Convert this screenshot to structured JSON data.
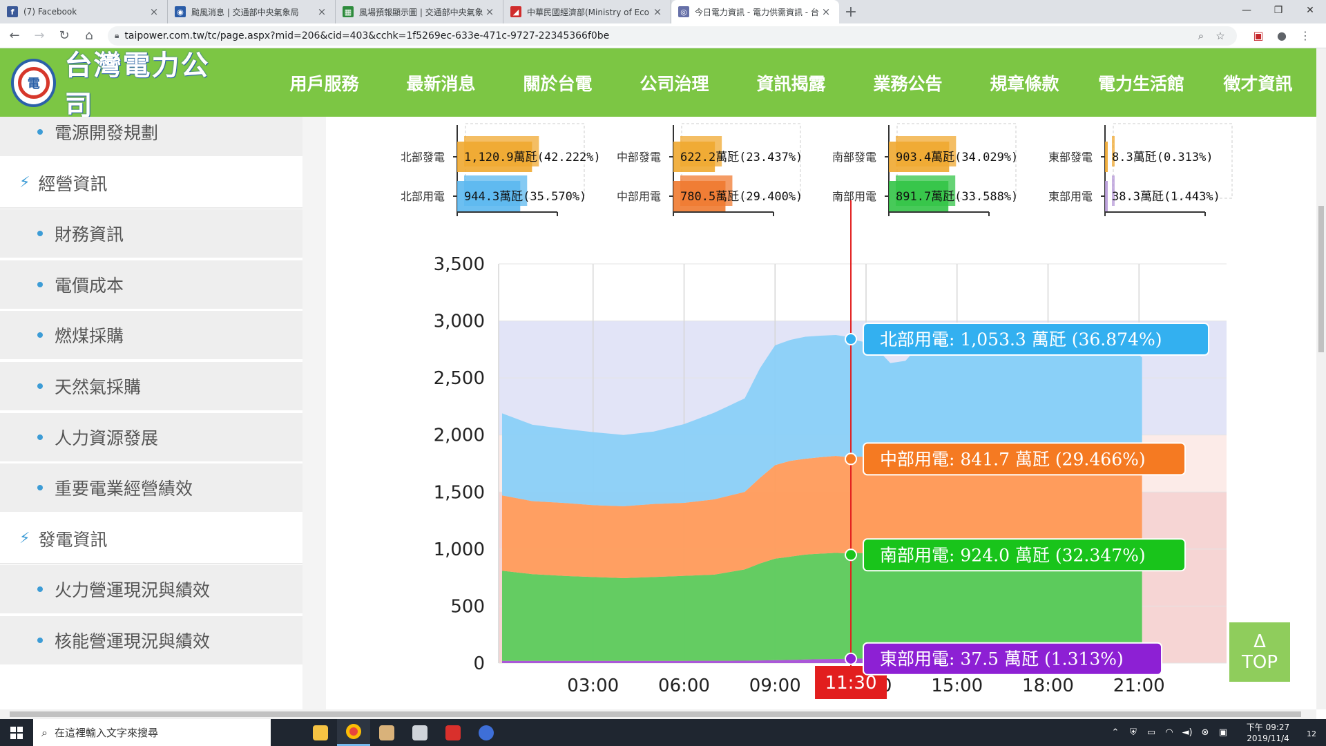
{
  "browser": {
    "tabs": [
      {
        "title": "(7) Facebook",
        "favicon": "facebook-icon",
        "color": "#3b5998",
        "glyph": "f"
      },
      {
        "title": "颱風消息 | 交通部中央氣象局",
        "favicon": "cwb-icon",
        "color": "#2a5ca8",
        "glyph": "◉"
      },
      {
        "title": "風場預報顯示圖 | 交通部中央氣象",
        "favicon": "wind-map-icon",
        "color": "#2e8b3d",
        "glyph": "▦"
      },
      {
        "title": "中華民國經濟部(Ministry of Eco",
        "favicon": "moea-icon",
        "color": "#d02c2c",
        "glyph": "◢"
      },
      {
        "title": "今日電力資訊 - 電力供需資訊 - 台",
        "favicon": "taipower-icon",
        "color": "#6670a8",
        "glyph": "◎"
      }
    ],
    "url": "taipower.com.tw/tc/page.aspx?mid=206&cid=403&cchk=1f5269ec-633e-471c-9727-22345366f0be"
  },
  "site": {
    "logo_text": "台灣電力公司",
    "logo_glyph": "電",
    "nav": [
      "用戶服務",
      "最新消息",
      "關於台電",
      "公司治理",
      "資訊揭露",
      "業務公告",
      "規章條款",
      "電力生活館",
      "徵才資訊"
    ]
  },
  "sidebar": {
    "items": [
      {
        "type": "sub",
        "label": "電源開發規劃"
      },
      {
        "type": "cat",
        "label": "經營資訊"
      },
      {
        "type": "sub",
        "label": "財務資訊"
      },
      {
        "type": "sub",
        "label": "電價成本"
      },
      {
        "type": "sub",
        "label": "燃煤採購"
      },
      {
        "type": "sub",
        "label": "天然氣採購"
      },
      {
        "type": "sub",
        "label": "人力資源發展"
      },
      {
        "type": "sub",
        "label": "重要電業經營績效"
      },
      {
        "type": "cat",
        "label": "發電資訊"
      },
      {
        "type": "sub",
        "label": "火力營運現況與績效"
      },
      {
        "type": "sub",
        "label": "核能營運現況與績效"
      }
    ]
  },
  "chart_data": [
    {
      "type": "bar",
      "panels": [
        {
          "rows": [
            {
              "label": "北部發電",
              "value": 1120.9,
              "text": "1,120.9萬瓩(42.222%)",
              "color": "#f0a830"
            },
            {
              "label": "北部用電",
              "value": 944.3,
              "text": "944.3萬瓩(35.570%)",
              "color": "#5cb8ef"
            }
          ]
        },
        {
          "rows": [
            {
              "label": "中部發電",
              "value": 622.2,
              "text": "622.2萬瓩(23.437%)",
              "color": "#f0a830"
            },
            {
              "label": "中部用電",
              "value": 780.5,
              "text": "780.5萬瓩(29.400%)",
              "color": "#f07a30"
            }
          ]
        },
        {
          "rows": [
            {
              "label": "南部發電",
              "value": 903.4,
              "text": "903.4萬瓩(34.029%)",
              "color": "#f0a830"
            },
            {
              "label": "南部用電",
              "value": 891.7,
              "text": "891.7萬瓩(33.588%)",
              "color": "#33c447"
            }
          ]
        },
        {
          "rows": [
            {
              "label": "東部發電",
              "value": 8.3,
              "text": "8.3萬瓩(0.313%)",
              "color": "#f0a830"
            },
            {
              "label": "東部用電",
              "value": 38.3,
              "text": "38.3萬瓩(1.443%)",
              "color": "#b79ad8"
            }
          ]
        }
      ],
      "xticks": [
        "0",
        "1,500"
      ],
      "xlim": [
        0,
        2000
      ]
    },
    {
      "type": "area",
      "stacked": true,
      "ylim": [
        0,
        3500
      ],
      "yticks": [
        "3,500",
        "3,000",
        "2,500",
        "2,000",
        "1,500",
        "1,000",
        "500",
        "0"
      ],
      "xticks": [
        "03:00",
        "06:00",
        "09:00",
        "12:00",
        "15:00",
        "18:00",
        "21:00"
      ],
      "x_range_hours": [
        0,
        24
      ],
      "bands": [
        {
          "from": 3000,
          "to": 3500,
          "color": "#ffffff"
        },
        {
          "from": 2000,
          "to": 3000,
          "color": "#e2e4f7"
        },
        {
          "from": 1500,
          "to": 2000,
          "color": "#fcebe8"
        },
        {
          "from": 0,
          "to": 1500,
          "color": "#f6d5d4"
        }
      ],
      "series": [
        {
          "name": "東部用電",
          "color": "#a650d8",
          "points": [
            [
              0,
              20
            ],
            [
              2,
              20
            ],
            [
              4,
              20
            ],
            [
              6,
              20
            ],
            [
              8,
              21
            ],
            [
              9.5,
              28
            ],
            [
              10.5,
              35
            ],
            [
              11.5,
              37.5
            ]
          ]
        },
        {
          "name": "南部用電",
          "color": "#5ccb5c",
          "points": [
            [
              0,
              790
            ],
            [
              1,
              760
            ],
            [
              2,
              745
            ],
            [
              3,
              735
            ],
            [
              4,
              725
            ],
            [
              5,
              735
            ],
            [
              6,
              745
            ],
            [
              7,
              755
            ],
            [
              8,
              800
            ],
            [
              8.5,
              850
            ],
            [
              9,
              890
            ],
            [
              9.5,
              905
            ],
            [
              10,
              920
            ],
            [
              11,
              930
            ],
            [
              11.5,
              924
            ]
          ]
        },
        {
          "name": "中部用電",
          "color": "#ff9c5c",
          "points": [
            [
              0,
              660
            ],
            [
              1,
              640
            ],
            [
              2,
              640
            ],
            [
              3,
              630
            ],
            [
              4,
              630
            ],
            [
              5,
              640
            ],
            [
              6,
              640
            ],
            [
              7,
              660
            ],
            [
              8,
              680
            ],
            [
              8.5,
              750
            ],
            [
              9,
              820
            ],
            [
              9.5,
              840
            ],
            [
              10,
              840
            ],
            [
              11,
              850
            ],
            [
              11.5,
              842
            ]
          ]
        },
        {
          "name": "北部用電",
          "color": "#8ad0f8",
          "points": [
            [
              0,
              720
            ],
            [
              1,
              670
            ],
            [
              2,
              650
            ],
            [
              3,
              640
            ],
            [
              4,
              625
            ],
            [
              5,
              635
            ],
            [
              6,
              690
            ],
            [
              7,
              760
            ],
            [
              7.5,
              790
            ],
            [
              8,
              820
            ],
            [
              8.5,
              960
            ],
            [
              9,
              1050
            ],
            [
              9.5,
              1060
            ],
            [
              10,
              1070
            ],
            [
              11,
              1060
            ],
            [
              11.5,
              1053
            ]
          ]
        },
        {
          "name": "北部用電 (forecast)",
          "color": "#8ad0f8",
          "points": [
            [
              11.5,
              2840
            ],
            [
              12.2,
              2800
            ],
            [
              12.8,
              2630
            ],
            [
              13.3,
              2650
            ],
            [
              13.8,
              2800
            ],
            [
              14.5,
              2730
            ],
            [
              16,
              2700
            ],
            [
              18,
              2700
            ],
            [
              20,
              2700
            ],
            [
              21,
              2700
            ],
            [
              21.1,
              2680
            ]
          ]
        }
      ],
      "cursor": {
        "label": "11:30",
        "hour": 11.5,
        "color": "#e21e1e"
      },
      "tooltips": [
        {
          "text": "北部用電: 1,053.3 萬瓩 (36.874%)",
          "color": "#33b0f0",
          "y": 2840
        },
        {
          "text": "中部用電: 841.7 萬瓩 (29.466%)",
          "color": "#f57a22",
          "y": 1790
        },
        {
          "text": "南部用電: 924.0 萬瓩 (32.347%)",
          "color": "#19c41b",
          "y": 949
        },
        {
          "text": "東部用電: 37.5 萬瓩 (1.313%)",
          "color": "#8d20d4",
          "y": 38
        }
      ]
    }
  ],
  "top_button": {
    "arrow": "Δ",
    "label": "TOP"
  },
  "taskbar": {
    "search_placeholder": "在這裡輸入文字來搜尋",
    "time": "下午 09:27",
    "date": "2019/11/4",
    "notifications": "12"
  }
}
